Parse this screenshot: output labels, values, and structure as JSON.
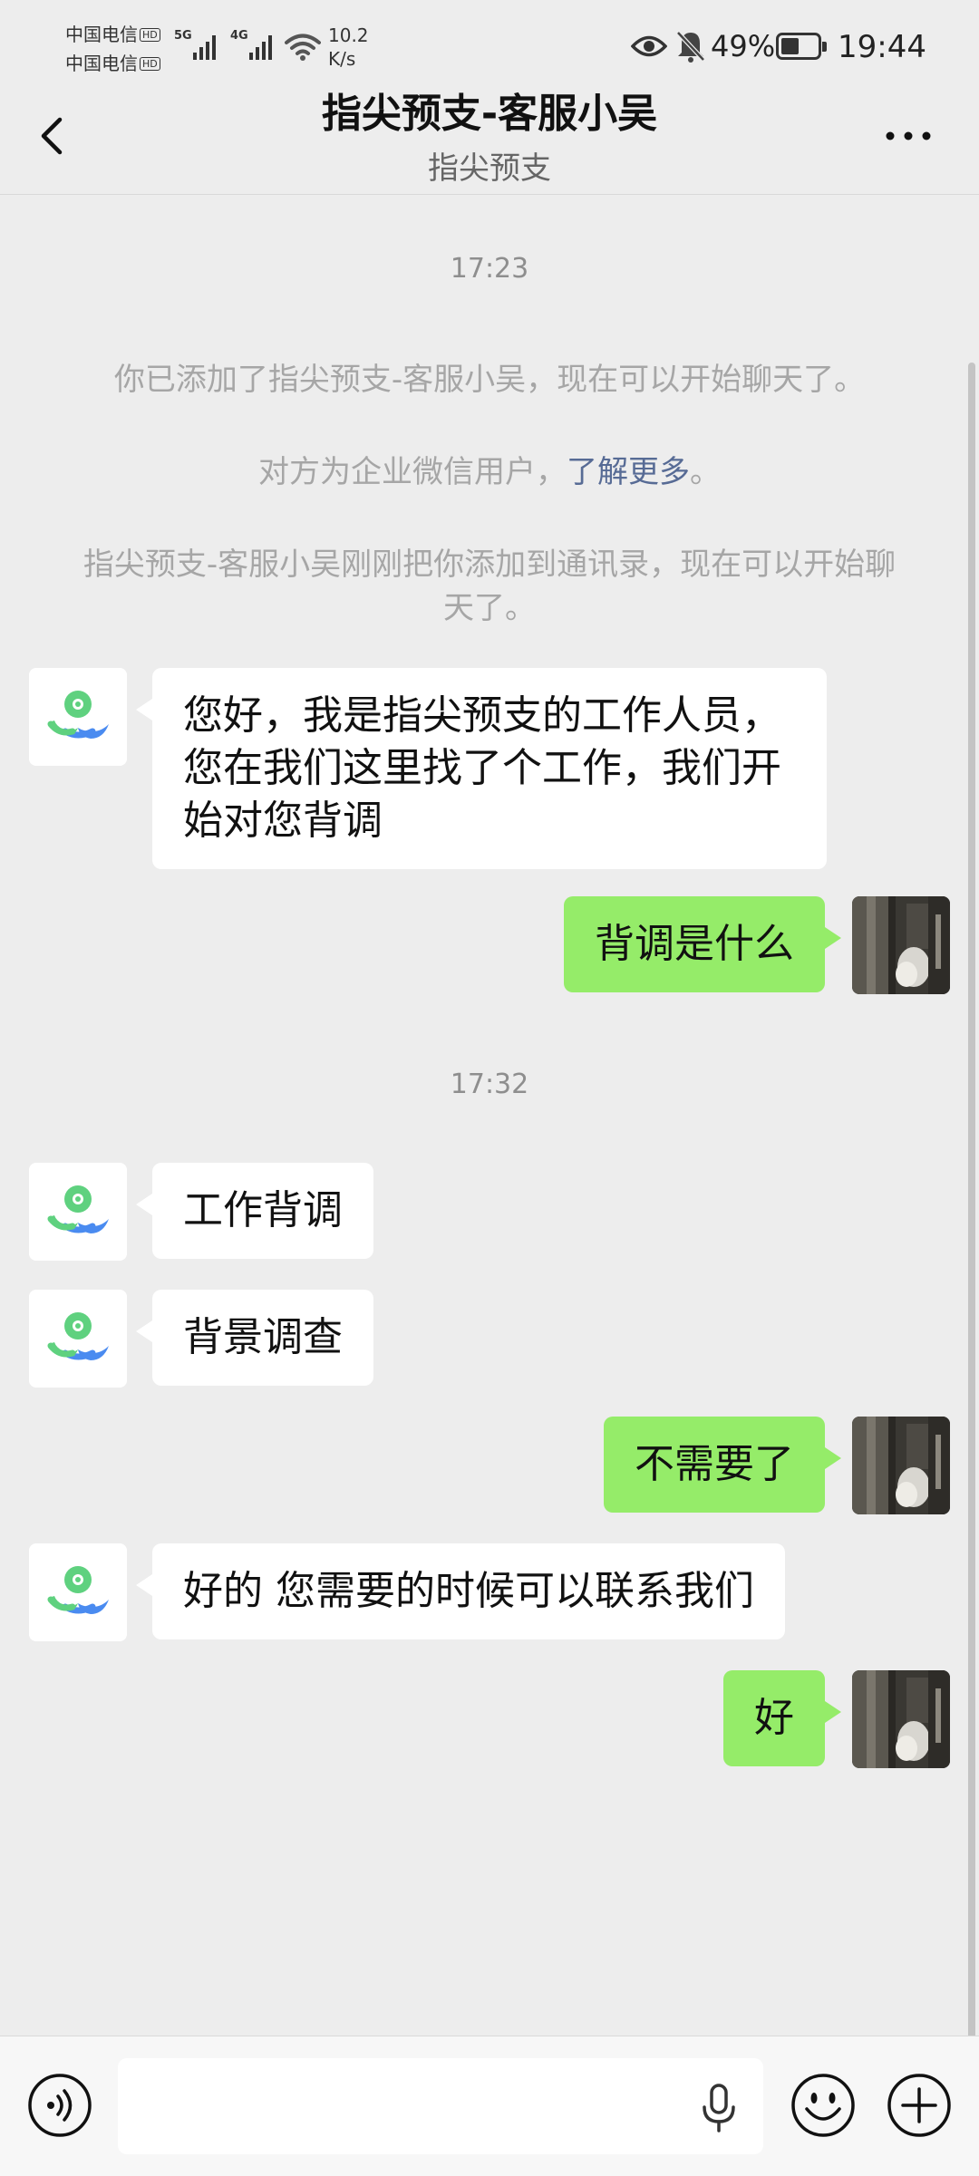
{
  "status_bar": {
    "carrier_1": "中国电信",
    "carrier_2": "中国电信",
    "hd_badge": "HD",
    "network_1": "5G",
    "network_2": "4G",
    "net_speed_value": "10.2",
    "net_speed_unit": "K/s",
    "battery_percent": "49%",
    "battery_level": 0.49,
    "time": "19:44",
    "icons": [
      "eye-icon",
      "bell-off-icon",
      "battery-icon",
      "wifi-icon",
      "signal-icon"
    ]
  },
  "header": {
    "title": "指尖预支-客服小吴",
    "subtitle": "指尖预支",
    "back_icon": "chevron-left-icon",
    "more_icon": "more-dots-icon"
  },
  "chat": {
    "timestamp_1": "17:23",
    "system_added": "你已添加了指尖预支-客服小吴，现在可以开始聊天了。",
    "system_enterprise_prefix": "对方为企业微信用户，",
    "system_enterprise_link": "了解更多",
    "system_enterprise_suffix": "。",
    "system_contact": "指尖预支-客服小吴刚刚把你添加到通讯录，现在可以开始聊天了。",
    "messages": [
      {
        "from": "other",
        "text": "您好，我是指尖预支的工作人员，您在我们这里找了个工作，我们开始对您背调"
      },
      {
        "from": "self",
        "text": "背调是什么"
      },
      {
        "from": "other",
        "text": "工作背调"
      },
      {
        "from": "other",
        "text": "背景调查"
      },
      {
        "from": "self",
        "text": "不需要了"
      },
      {
        "from": "other",
        "text": "好的 您需要的时候可以联系我们"
      },
      {
        "from": "self",
        "text": "好"
      }
    ],
    "timestamp_2": "17:32"
  },
  "input_bar": {
    "text_value": "",
    "icons": [
      "voice-icon",
      "microphone-icon",
      "emoji-icon",
      "plus-icon"
    ]
  },
  "colors": {
    "background": "#ededed",
    "self_bubble": "#95ec69",
    "other_bubble": "#ffffff",
    "link": "#576b95",
    "system_text": "#a6a6a6"
  }
}
